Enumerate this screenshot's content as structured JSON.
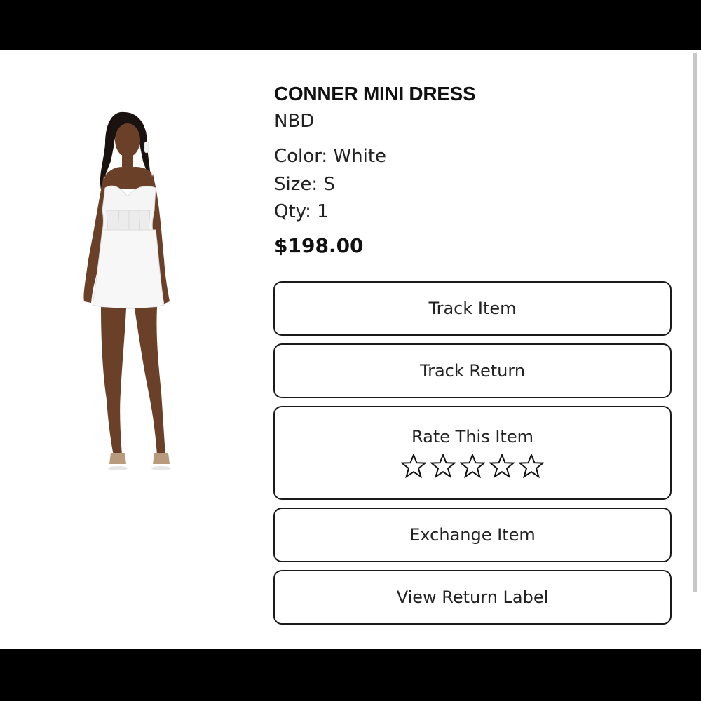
{
  "product": {
    "name": "CONNER MINI DRESS",
    "brand": "NBD",
    "color": "Color: White",
    "size": "Size: S",
    "qty": "Qty: 1",
    "price": "$198.00",
    "image_icon": "product-photo-white-strapless-mini-dress"
  },
  "actions": {
    "track_item": "Track Item",
    "track_return": "Track Return",
    "rate_item": "Rate This Item",
    "exchange_item": "Exchange Item",
    "view_return_label": "View Return Label"
  },
  "rating": {
    "max_stars": 5,
    "current": 0,
    "star_icon": "star-outline-icon"
  },
  "colors": {
    "background": "#ffffff",
    "frame": "#000000",
    "text": "#111111",
    "button_border": "#1a1a1a"
  }
}
